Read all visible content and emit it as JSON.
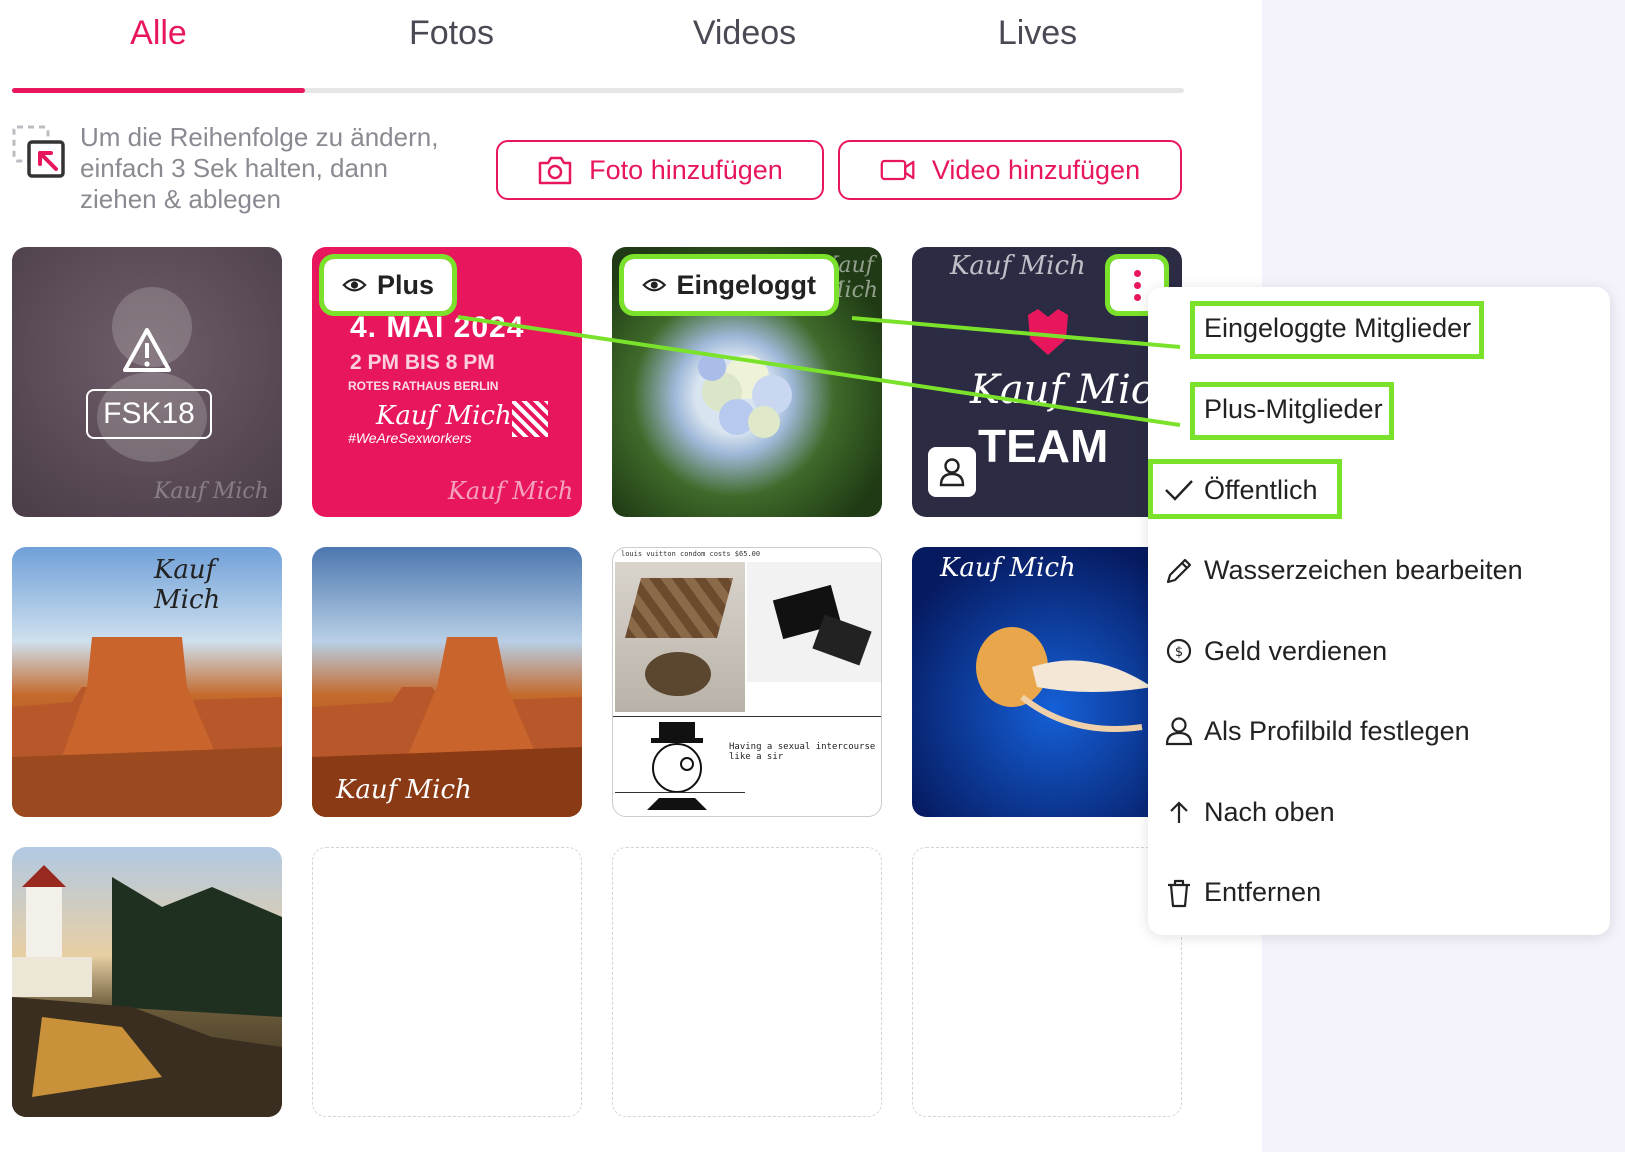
{
  "tabs": [
    {
      "label": "Alle",
      "active": true
    },
    {
      "label": "Fotos",
      "active": false
    },
    {
      "label": "Videos",
      "active": false
    },
    {
      "label": "Lives",
      "active": false
    }
  ],
  "hint": {
    "text": "Um die Reihenfolge zu ändern, einfach 3 Sek halten, dann ziehen & ablegen"
  },
  "buttons": {
    "add_photo": "Foto hinzufügen",
    "add_video": "Video hinzufügen"
  },
  "tiles": {
    "fsk": {
      "label": "FSK18"
    },
    "plus": {
      "badge": "Plus",
      "headline": "4. MAI 2024",
      "time": "2 PM BIS 8 PM",
      "place": "ROTES RATHAUS BERLIN",
      "tag": "#WeAreSexworkers"
    },
    "loggedin": {
      "badge": "Eingeloggt"
    },
    "team": {
      "text": "TEAM"
    },
    "meme": {
      "top": "louis vuitton condom costs $65.00",
      "caption": "Having a sexual intercourse like a sir"
    },
    "watermark": "Kauf Mich"
  },
  "menu": {
    "items": [
      {
        "label": "Eingeloggte Mitglieder",
        "icon": "none"
      },
      {
        "label": "Plus-Mitglieder",
        "icon": "none"
      },
      {
        "label": "Öffentlich",
        "icon": "check-icon",
        "selected": true
      },
      {
        "label": "Wasserzeichen bearbeiten",
        "icon": "pencil-icon"
      },
      {
        "label": "Geld verdienen",
        "icon": "coin-icon"
      },
      {
        "label": "Als Profilbild festlegen",
        "icon": "person-icon"
      },
      {
        "label": "Nach oben",
        "icon": "arrow-up-icon"
      },
      {
        "label": "Entfernen",
        "icon": "trash-icon"
      }
    ]
  },
  "colors": {
    "accent": "#e8175d",
    "highlight": "#7be22b",
    "sidebar": "#f4f3fb"
  }
}
